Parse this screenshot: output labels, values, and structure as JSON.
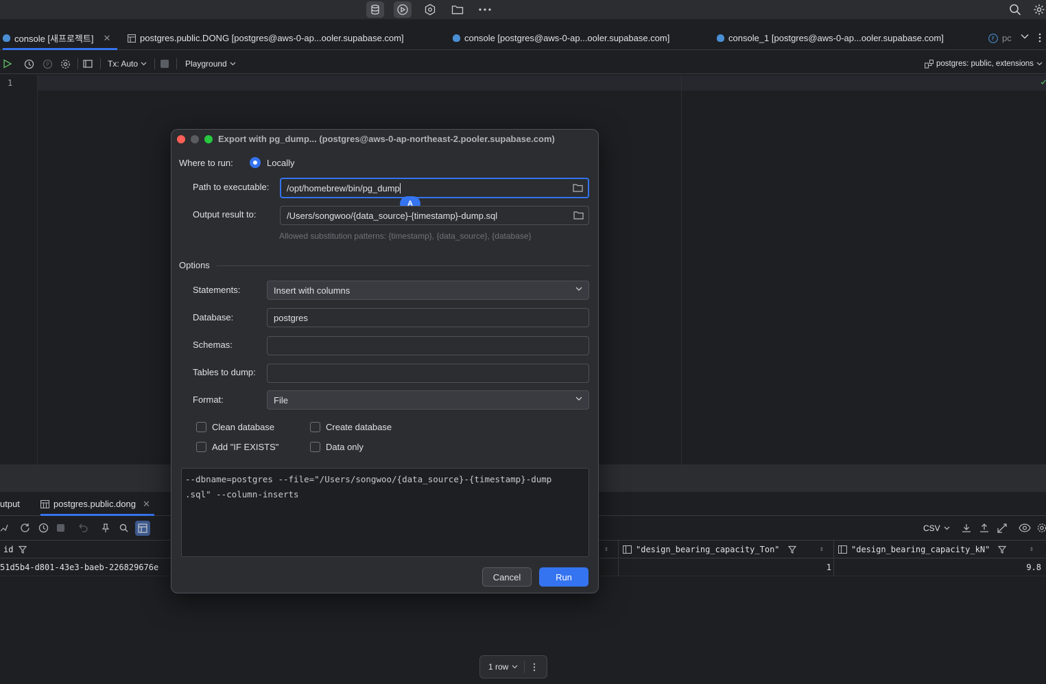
{
  "tabs": [
    {
      "label": "console [새프로젝트]",
      "active": true
    },
    {
      "label": "postgres.public.DONG [postgres@aws-0-ap...ooler.supabase.com]"
    },
    {
      "label": "console [postgres@aws-0-ap...ooler.supabase.com]"
    },
    {
      "label": "console_1 [postgres@aws-0-ap...ooler.supabase.com]"
    },
    {
      "label": "pc"
    }
  ],
  "toolbar": {
    "tx_label": "Tx: Auto",
    "playground_label": "Playground",
    "schema_label": "postgres: public, extensions"
  },
  "editor": {
    "line_number": "1"
  },
  "dialog": {
    "title": "Export with pg_dump... (postgres@aws-0-ap-northeast-2.pooler.supabase.com)",
    "where_label": "Where to run:",
    "where_value": "Locally",
    "path_label": "Path to executable:",
    "path_value": "/opt/homebrew/bin/pg_dump",
    "output_label": "Output result to:",
    "output_value": "/Users/songwoo/{data_source}-{timestamp}-dump.sql",
    "hint": "Allowed substitution patterns: {timestamp}, {data_source}, {database}",
    "options_label": "Options",
    "statements_label": "Statements:",
    "statements_value": "Insert with columns",
    "database_label": "Database:",
    "database_value": "postgres",
    "schemas_label": "Schemas:",
    "schemas_value": "",
    "tables_label": "Tables to dump:",
    "tables_value": "",
    "format_label": "Format:",
    "format_value": "File",
    "checkboxes": [
      {
        "label": "Clean database",
        "checked": false
      },
      {
        "label": "Create database",
        "checked": false
      },
      {
        "label": "Add \"IF EXISTS\"",
        "checked": false
      },
      {
        "label": "Data only",
        "checked": false
      }
    ],
    "command_line1": "--dbname=postgres --file=\"/Users/songwoo/{data_source}-{timestamp}-dump",
    "command_line2": ".sql\" --column-inserts",
    "cancel_label": "Cancel",
    "run_label": "Run",
    "cursor_badge": "A"
  },
  "bottom": {
    "tab_output": "utput",
    "tab_table": "postgres.public.dong",
    "csv_label": "CSV",
    "columns": [
      "id",
      "\"design_bearing_capacity_Ton\"",
      "\"design_bearing_capacity_kN\""
    ],
    "row": [
      "51d5b4-d801-43e3-baeb-226829676e",
      "1",
      "9.8"
    ],
    "row_count": "1 row"
  },
  "colors": {
    "accent": "#3574f0",
    "background": "#1e1f22",
    "panel": "#2b2d30"
  }
}
